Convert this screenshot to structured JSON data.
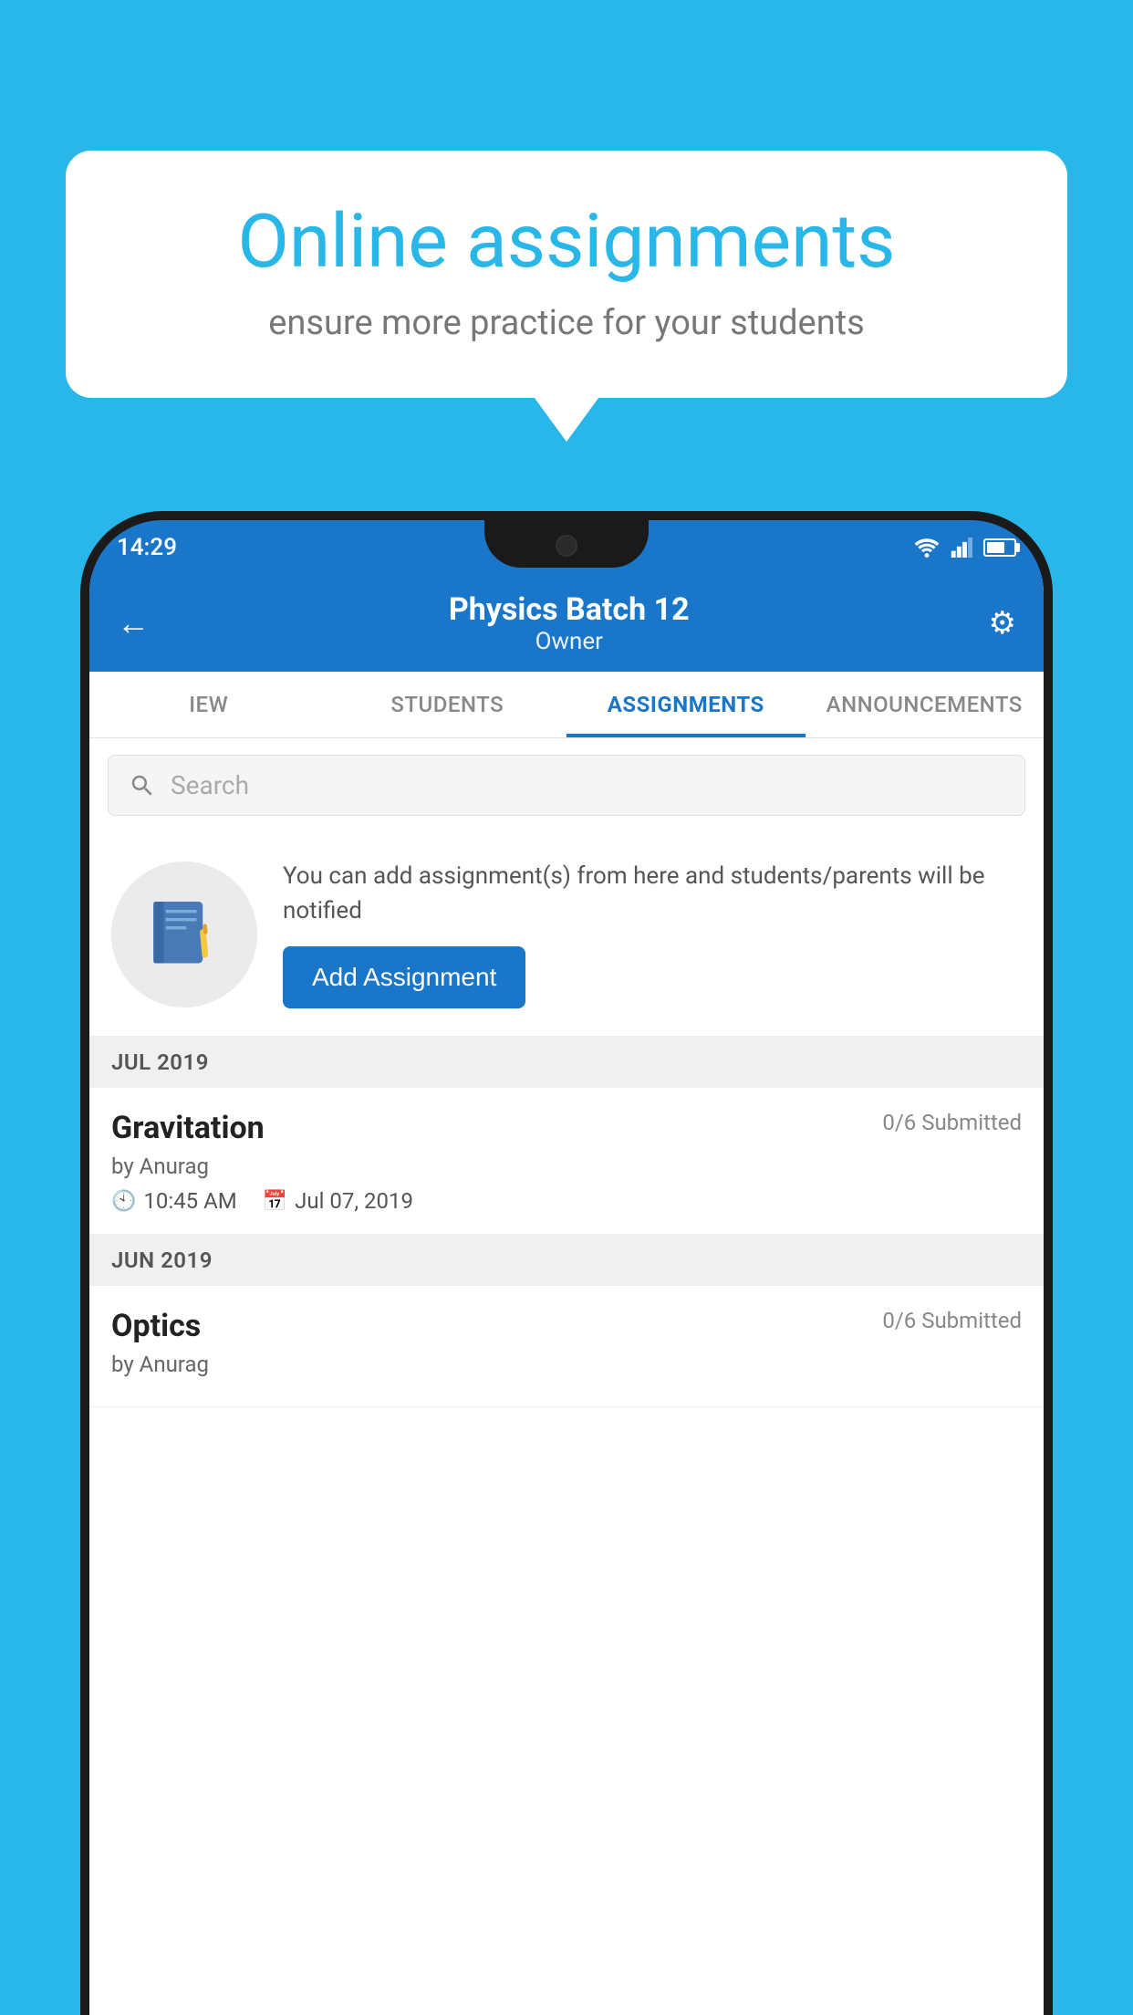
{
  "background_color": "#29b6e8",
  "speech_bubble": {
    "title": "Online assignments",
    "subtitle": "ensure more practice for your students"
  },
  "status_bar": {
    "time": "14:29"
  },
  "app_header": {
    "title": "Physics Batch 12",
    "subtitle": "Owner",
    "back_label": "←",
    "settings_label": "⚙"
  },
  "tabs": [
    {
      "label": "IEW",
      "active": false
    },
    {
      "label": "STUDENTS",
      "active": false
    },
    {
      "label": "ASSIGNMENTS",
      "active": true
    },
    {
      "label": "ANNOUNCEMENTS",
      "active": false
    }
  ],
  "search": {
    "placeholder": "Search"
  },
  "promo": {
    "description": "You can add assignment(s) from here and students/parents will be notified",
    "button_label": "Add Assignment"
  },
  "sections": [
    {
      "month": "JUL 2019",
      "assignments": [
        {
          "name": "Gravitation",
          "submitted": "0/6 Submitted",
          "author": "by Anurag",
          "time": "10:45 AM",
          "date": "Jul 07, 2019"
        }
      ]
    },
    {
      "month": "JUN 2019",
      "assignments": [
        {
          "name": "Optics",
          "submitted": "0/6 Submitted",
          "author": "by Anurag",
          "time": "",
          "date": ""
        }
      ]
    }
  ]
}
